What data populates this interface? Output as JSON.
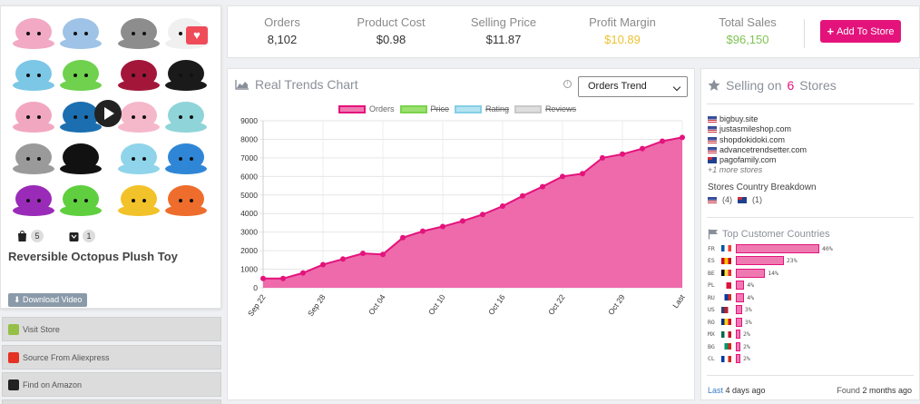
{
  "product": {
    "title": "Reversible Octopus Plush Toy",
    "download_label": "Download Video",
    "shopify_count": "5",
    "store_count": "1"
  },
  "actions": [
    {
      "label": "Visit Store",
      "icon": "shopify-icon",
      "color": "#95bf47"
    },
    {
      "label": "Source From Aliexpress",
      "icon": "aliexpress-icon",
      "color": "#e43225"
    },
    {
      "label": "Find on Amazon",
      "icon": "amazon-icon",
      "color": "#222222"
    }
  ],
  "stats": {
    "orders_label": "Orders",
    "orders_value": "8,102",
    "cost_label": "Product Cost",
    "cost_value": "$0.98",
    "price_label": "Selling Price",
    "price_value": "$11.87",
    "margin_label": "Profit Margin",
    "margin_value": "$10.89",
    "sales_label": "Total Sales",
    "sales_value": "$96,150",
    "add_label": "Add To Store"
  },
  "chart_panel": {
    "title": "Real Trends Chart",
    "select_value": "Orders Trend"
  },
  "chart_data": {
    "type": "area",
    "title": "",
    "legend": [
      {
        "name": "Orders",
        "color": "#e4137c",
        "active": true
      },
      {
        "name": "Price",
        "color": "#7bd34e",
        "active": false
      },
      {
        "name": "Rating",
        "color": "#85cfe6",
        "active": false
      },
      {
        "name": "Reviews",
        "color": "#c9c9c9",
        "active": false
      }
    ],
    "ylim": [
      0,
      9000
    ],
    "yticks": [
      0,
      1000,
      2000,
      3000,
      4000,
      5000,
      6000,
      7000,
      8000,
      9000
    ],
    "x_ticks": [
      "Sep 22",
      "Sep 28",
      "Oct 04",
      "Oct 10",
      "Oct 16",
      "Oct 22",
      "Oct 29",
      "Last"
    ],
    "series": [
      {
        "name": "Orders",
        "values": [
          500,
          500,
          800,
          1250,
          1550,
          1850,
          1800,
          2700,
          3050,
          3300,
          3600,
          3950,
          4400,
          4950,
          5450,
          6000,
          6150,
          7000,
          7200,
          7500,
          7900,
          8100
        ]
      }
    ]
  },
  "stores_panel": {
    "title_prefix": "Selling on",
    "count": "6",
    "title_suffix": "Stores",
    "stores": [
      "bigbuy.site",
      "justasmileshop.com",
      "shopdokidoki.com",
      "advancetrendsetter.com",
      "pagofamily.com"
    ],
    "more": "+1 more stores",
    "breakdown_title": "Stores Country Breakdown",
    "breakdown": [
      {
        "flag": "US",
        "count": "(4)"
      },
      {
        "flag": "AU",
        "count": "(1)"
      }
    ],
    "countries_title": "Top Customer Countries",
    "countries": [
      {
        "code": "FR",
        "pct": 40,
        "label": "40%",
        "flag": [
          "#0055a4",
          "#ffffff",
          "#ef4135"
        ]
      },
      {
        "code": "ES",
        "pct": 23,
        "label": "23%",
        "flag": [
          "#c60b1e",
          "#ffc400",
          "#c60b1e"
        ]
      },
      {
        "code": "BE",
        "pct": 14,
        "label": "14%",
        "flag": [
          "#000000",
          "#fae042",
          "#ed2939"
        ]
      },
      {
        "code": "PL",
        "pct": 4,
        "label": "4%",
        "flag": [
          "#ffffff",
          "#dc143c"
        ]
      },
      {
        "code": "RU",
        "pct": 4,
        "label": "4%",
        "flag": [
          "#ffffff",
          "#0039a6",
          "#d52b1e"
        ]
      },
      {
        "code": "US",
        "pct": 3,
        "label": "3%",
        "flag": [
          "#3c3b6e",
          "#b22234",
          "#ffffff"
        ]
      },
      {
        "code": "RO",
        "pct": 3,
        "label": "3%",
        "flag": [
          "#002b7f",
          "#fcd116",
          "#ce1126"
        ]
      },
      {
        "code": "MX",
        "pct": 2,
        "label": "2%",
        "flag": [
          "#006847",
          "#ffffff",
          "#ce1126"
        ]
      },
      {
        "code": "BG",
        "pct": 2,
        "label": "2%",
        "flag": [
          "#ffffff",
          "#00966e",
          "#d62612"
        ]
      },
      {
        "code": "CL",
        "pct": 2,
        "label": "2%",
        "flag": [
          "#0039a6",
          "#ffffff",
          "#d52b1e"
        ]
      }
    ],
    "last_label": "Last",
    "last_value": "4 days ago",
    "found_label": "Found",
    "found_value": "2 months ago"
  }
}
